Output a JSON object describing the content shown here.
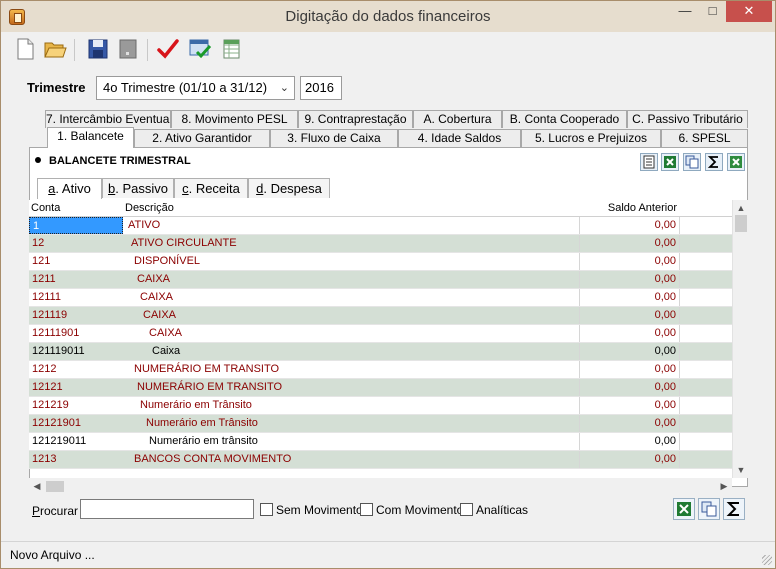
{
  "window": {
    "title": "Digitação do dados financeiros"
  },
  "toolbar": {
    "buttons": [
      {
        "name": "new-document-icon"
      },
      {
        "name": "open-folder-icon"
      },
      {
        "name": "save-icon"
      },
      {
        "name": "save-disabled-icon"
      },
      {
        "name": "checkmark-icon"
      },
      {
        "name": "window-check-icon"
      },
      {
        "name": "spreadsheet-icon"
      }
    ]
  },
  "trimestre": {
    "label": "Trimestre",
    "selected": "4o Trimestre (01/10 a 31/12)",
    "year": "2016"
  },
  "tabs_back": [
    "7. Intercâmbio Eventual",
    "8. Movimento PESL",
    "9. Contraprestação",
    "A. Cobertura",
    "B. Conta Cooperado",
    "C. Passivo Tributário"
  ],
  "tabs_front": [
    "1. Balancete",
    "2. Ativo Garantidor",
    "3. Fluxo de Caixa",
    "4. Idade Saldos",
    "5. Lucros e Prejuizos",
    "6. SPESL"
  ],
  "panel": {
    "title": "BALANCETE TRIMESTRAL"
  },
  "subtabs": [
    {
      "key": "a",
      "rest": ". Ativo"
    },
    {
      "key": "b",
      "rest": ". Passivo"
    },
    {
      "key": "c",
      "rest": ". Receita"
    },
    {
      "key": "d",
      "rest": ". Despesa"
    }
  ],
  "grid": {
    "headers": {
      "conta": "Conta",
      "descricao": "Descrição",
      "saldo": "Saldo Anterior"
    },
    "rows": [
      {
        "conta": "1",
        "descricao": "ATIVO",
        "indent": 0,
        "saldo": "0,00",
        "color": "#8b0000"
      },
      {
        "conta": "12",
        "descricao": "ATIVO CIRCULANTE",
        "indent": 1,
        "saldo": "0,00",
        "color": "#8b0000"
      },
      {
        "conta": "121",
        "descricao": "DISPONÍVEL",
        "indent": 2,
        "saldo": "0,00",
        "color": "#8b0000"
      },
      {
        "conta": "1211",
        "descricao": "CAIXA",
        "indent": 3,
        "saldo": "0,00",
        "color": "#8b0000"
      },
      {
        "conta": "12111",
        "descricao": "CAIXA",
        "indent": 4,
        "saldo": "0,00",
        "color": "#8b0000"
      },
      {
        "conta": "121119",
        "descricao": "CAIXA",
        "indent": 5,
        "saldo": "0,00",
        "color": "#8b0000"
      },
      {
        "conta": "12111901",
        "descricao": "CAIXA",
        "indent": 7,
        "saldo": "0,00",
        "color": "#8b0000"
      },
      {
        "conta": "121119011",
        "descricao": "Caixa",
        "indent": 8,
        "saldo": "0,00",
        "color": "#000000"
      },
      {
        "conta": "1212",
        "descricao": "NUMERÁRIO EM TRANSITO",
        "indent": 2,
        "saldo": "0,00",
        "color": "#8b0000"
      },
      {
        "conta": "12121",
        "descricao": "NUMERÁRIO EM TRANSITO",
        "indent": 3,
        "saldo": "0,00",
        "color": "#8b0000"
      },
      {
        "conta": "121219",
        "descricao": "Numerário em Trânsito",
        "indent": 4,
        "saldo": "0,00",
        "color": "#8b0000"
      },
      {
        "conta": "12121901",
        "descricao": "Numerário em Trânsito",
        "indent": 6,
        "saldo": "0,00",
        "color": "#8b0000"
      },
      {
        "conta": "121219011",
        "descricao": "Numerário em trânsito",
        "indent": 7,
        "saldo": "0,00",
        "color": "#000000"
      },
      {
        "conta": "1213",
        "descricao": "BANCOS CONTA MOVIMENTO",
        "indent": 2,
        "saldo": "0,00",
        "color": "#8b0000"
      }
    ]
  },
  "search": {
    "label_key": "P",
    "label_rest": "rocurar",
    "value": "",
    "checkboxes": [
      "Sem Movimento",
      "Com Movimento",
      "Analíticas"
    ]
  },
  "status": {
    "text": "Novo Arquivo ..."
  },
  "colors": {
    "row_alt": "#d4dfd5",
    "selection": "#3399ff",
    "row_text": "#8b0000"
  }
}
